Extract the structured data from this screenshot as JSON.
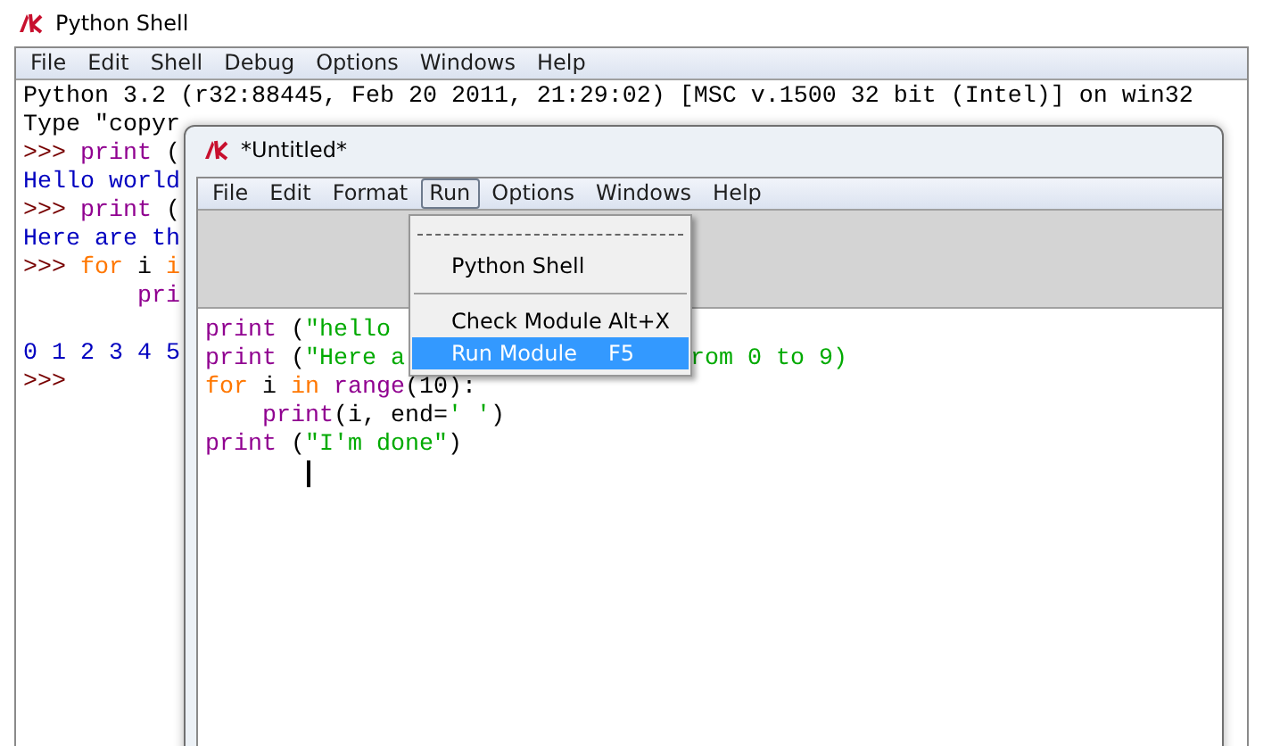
{
  "shell": {
    "title": "Python Shell",
    "menu": [
      {
        "label": "File",
        "selected": false
      },
      {
        "label": "Edit",
        "selected": false
      },
      {
        "label": "Shell",
        "selected": false
      },
      {
        "label": "Debug",
        "selected": false
      },
      {
        "label": "Options",
        "selected": false
      },
      {
        "label": "Windows",
        "selected": false
      },
      {
        "label": "Help",
        "selected": false
      }
    ],
    "lines": [
      {
        "kind": "text",
        "indent": false,
        "segments": [
          {
            "kind": "plain",
            "text": "Python 3.2 (r32:88445, Feb 20 2011, 21:29:02) [MSC v.1500 32 bit (Intel)] on win32"
          }
        ]
      },
      {
        "kind": "text",
        "indent": false,
        "segments": [
          {
            "kind": "plain",
            "text": "Type \"copyr"
          }
        ]
      },
      {
        "kind": "text",
        "indent": false,
        "segments": [
          {
            "kind": "prompt",
            "text": ">>> "
          },
          {
            "kind": "builtin",
            "text": "print"
          },
          {
            "kind": "plain",
            "text": " ("
          }
        ]
      },
      {
        "kind": "text",
        "indent": false,
        "segments": [
          {
            "kind": "output",
            "text": "Hello world"
          }
        ]
      },
      {
        "kind": "text",
        "indent": false,
        "segments": [
          {
            "kind": "prompt",
            "text": ">>> "
          },
          {
            "kind": "builtin",
            "text": "print"
          },
          {
            "kind": "plain",
            "text": " ("
          }
        ]
      },
      {
        "kind": "text",
        "indent": false,
        "segments": [
          {
            "kind": "output",
            "text": "Here are th"
          }
        ]
      },
      {
        "kind": "text",
        "indent": false,
        "segments": [
          {
            "kind": "prompt",
            "text": ">>> "
          },
          {
            "kind": "keyword",
            "text": "for"
          },
          {
            "kind": "plain",
            "text": " i "
          },
          {
            "kind": "keyword",
            "text": "i"
          }
        ]
      },
      {
        "kind": "text",
        "indent": true,
        "segments": [
          {
            "kind": "builtin",
            "text": "pri"
          }
        ]
      },
      {
        "kind": "blank"
      },
      {
        "kind": "text",
        "indent": false,
        "segments": [
          {
            "kind": "output",
            "text": "0 1 2 3 4 5"
          }
        ]
      },
      {
        "kind": "text",
        "indent": false,
        "segments": [
          {
            "kind": "prompt",
            "text": ">>>"
          }
        ]
      }
    ]
  },
  "editor": {
    "title": "*Untitled*",
    "menu": [
      {
        "label": "File",
        "selected": false
      },
      {
        "label": "Edit",
        "selected": false
      },
      {
        "label": "Format",
        "selected": false
      },
      {
        "label": "Run",
        "selected": true
      },
      {
        "label": "Options",
        "selected": false
      },
      {
        "label": "Windows",
        "selected": false
      },
      {
        "label": "Help",
        "selected": false
      }
    ],
    "lines": [
      {
        "indent": false,
        "segments": [
          {
            "kind": "builtin",
            "text": "print"
          },
          {
            "kind": "plain",
            "text": " ("
          },
          {
            "kind": "string",
            "text": "\"hello"
          }
        ]
      },
      {
        "indent": false,
        "segments": [
          {
            "kind": "builtin",
            "text": "print"
          },
          {
            "kind": "plain",
            "text": " ("
          },
          {
            "kind": "string",
            "text": "\"Here a"
          }
        ],
        "resume": [
          {
            "kind": "string",
            "text": "rom 0 to 9)"
          }
        ]
      },
      {
        "indent": false,
        "segments": [
          {
            "kind": "keyword",
            "text": "for"
          },
          {
            "kind": "plain",
            "text": " i "
          },
          {
            "kind": "keyword",
            "text": "in "
          },
          {
            "kind": "builtin",
            "text": "range"
          },
          {
            "kind": "plain",
            "text": "(10):"
          }
        ]
      },
      {
        "indent": true,
        "segments": [
          {
            "kind": "builtin",
            "text": "print"
          },
          {
            "kind": "plain",
            "text": "(i, end="
          },
          {
            "kind": "string",
            "text": "' '"
          },
          {
            "kind": "plain",
            "text": ")"
          }
        ]
      },
      {
        "indent": false,
        "segments": [
          {
            "kind": "builtin",
            "text": "print"
          },
          {
            "kind": "plain",
            "text": " ("
          },
          {
            "kind": "string",
            "text": "\"I'm done\""
          },
          {
            "kind": "plain",
            "text": ")"
          }
        ]
      }
    ],
    "run_menu": [
      {
        "kind": "tearoff"
      },
      {
        "kind": "item",
        "label": "Python Shell",
        "selected": false
      },
      {
        "kind": "separator"
      },
      {
        "kind": "item",
        "label": "Check Module",
        "shortcut": "Alt+X",
        "selected": false
      },
      {
        "kind": "item",
        "label": "Run Module",
        "shortcut": "F5",
        "selected": true
      }
    ]
  }
}
